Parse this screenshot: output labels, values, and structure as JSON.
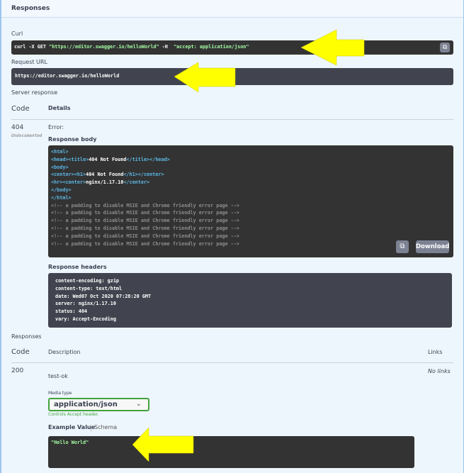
{
  "section_title": "Responses",
  "curl": {
    "label": "Curl",
    "command_prefix": "curl -X GET ",
    "command_url": "\"https://editor.swagger.io/helloWorld\"",
    "command_flag": " -H ",
    "command_header": " \"accept: application/json\""
  },
  "request_url": {
    "label": "Request URL",
    "value": "https://editor.swagger.io/helloWorld"
  },
  "server_response": {
    "label": "Server response",
    "col_code": "Code",
    "col_details": "Details",
    "code": "404",
    "code_note": "Undocumented",
    "error_label": "Error:",
    "body_label": "Response body",
    "body_lines": [
      {
        "k": "tag",
        "t": "<html>"
      },
      {
        "k": "mix",
        "a": "<head><title>",
        "b": "404 Not Found",
        "c": "</title></head>"
      },
      {
        "k": "tag",
        "t": "<body>"
      },
      {
        "k": "mix",
        "a": "<center><h1>",
        "b": "404 Not Found",
        "c": "</h1></center>"
      },
      {
        "k": "mix",
        "a": "<hr><center>",
        "b": "nginx/1.17.10",
        "c": "</center>"
      },
      {
        "k": "tag",
        "t": "</body>"
      },
      {
        "k": "tag",
        "t": "</html>"
      },
      {
        "k": "cmt",
        "t": "<!-- a padding to disable MSIE and Chrome friendly error page -->"
      },
      {
        "k": "cmt",
        "t": "<!-- a padding to disable MSIE and Chrome friendly error page -->"
      },
      {
        "k": "cmt",
        "t": "<!-- a padding to disable MSIE and Chrome friendly error page -->"
      },
      {
        "k": "cmt",
        "t": "<!-- a padding to disable MSIE and Chrome friendly error page -->"
      },
      {
        "k": "cmt",
        "t": "<!-- a padding to disable MSIE and Chrome friendly error page -->"
      },
      {
        "k": "cmt",
        "t": "<!-- a padding to disable MSIE and Chrome friendly error page -->"
      }
    ],
    "download_label": "Download",
    "headers_label": "Response headers",
    "headers": [
      "content-encoding: gzip",
      "content-type: text/html",
      "date: Wed07 Oct 2020 07:28:20 GMT",
      "server: nginx/1.17.10",
      "status: 404",
      "vary: Accept-Encoding"
    ]
  },
  "responses": {
    "label": "Responses",
    "col_code": "Code",
    "col_description": "Description",
    "col_links": "Links",
    "code": "200",
    "description": "test-ok",
    "links": "No links",
    "media_type_label": "Media type",
    "media_type": "application/json",
    "controls_note": "Controls Accept header.",
    "tab_example": "Example Value",
    "tab_schema": "Schema",
    "example": "\"Hello World\""
  },
  "colors": {
    "arrow": "#ffff00",
    "green": "#49cc90",
    "tag": "#5cb8e6"
  }
}
